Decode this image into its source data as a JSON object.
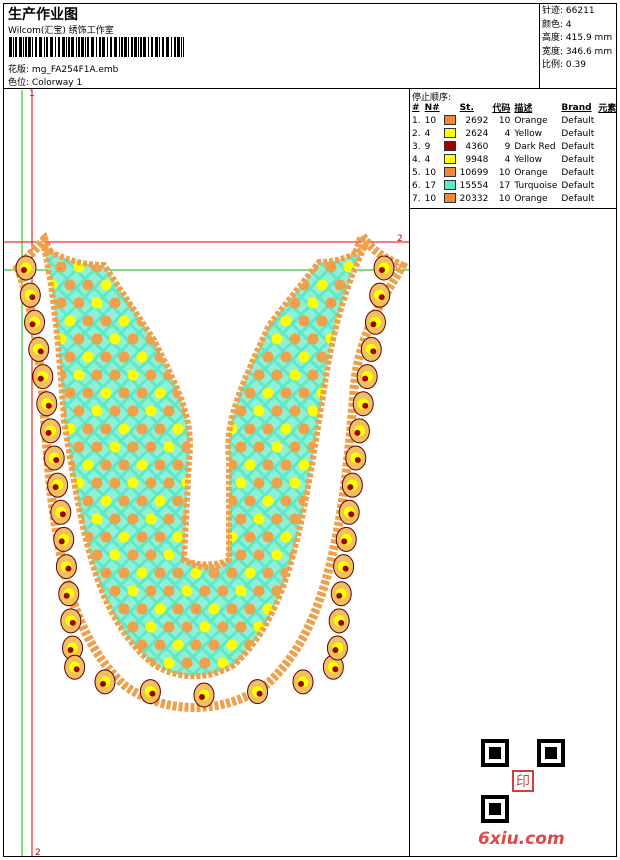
{
  "header": {
    "title": "生产作业图",
    "company": "Wilcom(汇宝) 绣饰工作室",
    "design_label": "花版:",
    "design_name": "mg_FA254F1A.emb",
    "colorway_label": "色位:",
    "colorway_name": "Colorway 1"
  },
  "specs": [
    {
      "label": "针迹:",
      "value": "66211"
    },
    {
      "label": "颜色:",
      "value": "4"
    },
    {
      "label": "高度:",
      "value": "415.9 mm"
    },
    {
      "label": "宽度:",
      "value": "346.6 mm"
    },
    {
      "label": "比例:",
      "value": "0.39"
    }
  ],
  "stop_sequence": {
    "title": "停止顺序:",
    "columns": [
      "#",
      "N#",
      "St.",
      "代码",
      "描述",
      "Brand",
      "元素"
    ],
    "rows": [
      {
        "idx": "1.",
        "n": "10",
        "color": "#f0873a",
        "st": "2692",
        "code": "10",
        "desc": "Orange",
        "brand": "Default"
      },
      {
        "idx": "2.",
        "n": "4",
        "color": "#ffff00",
        "st": "2624",
        "code": "4",
        "desc": "Yellow",
        "brand": "Default"
      },
      {
        "idx": "3.",
        "n": "9",
        "color": "#a00000",
        "st": "4360",
        "code": "9",
        "desc": "Dark Red",
        "brand": "Default"
      },
      {
        "idx": "4.",
        "n": "4",
        "color": "#ffff00",
        "st": "9948",
        "code": "4",
        "desc": "Yellow",
        "brand": "Default"
      },
      {
        "idx": "5.",
        "n": "10",
        "color": "#f0873a",
        "st": "10699",
        "code": "10",
        "desc": "Orange",
        "brand": "Default"
      },
      {
        "idx": "6.",
        "n": "17",
        "color": "#5fe8c8",
        "st": "15554",
        "code": "17",
        "desc": "Turquoise",
        "brand": "Default"
      },
      {
        "idx": "7.",
        "n": "10",
        "color": "#f0873a",
        "st": "20332",
        "code": "10",
        "desc": "Orange",
        "brand": "Default"
      }
    ]
  },
  "guides": {
    "top_label": "1",
    "right_label": "2",
    "bottom_label": "2",
    "colors": {
      "red": "#e00000",
      "green": "#00c000"
    }
  },
  "watermark": "6xiu.com",
  "qr_stamp": "印"
}
